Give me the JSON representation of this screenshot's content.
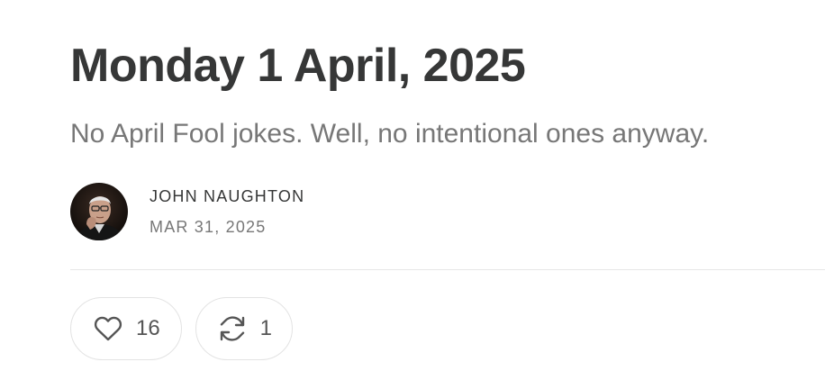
{
  "post": {
    "title": "Monday 1 April, 2025",
    "subtitle": "No April Fool jokes. Well, no intentional ones anyway."
  },
  "byline": {
    "author": "JOHN NAUGHTON",
    "date": "MAR 31, 2025",
    "avatar_icon": "author-avatar"
  },
  "actions": {
    "like": {
      "icon": "heart-icon",
      "count": "16"
    },
    "restack": {
      "icon": "restack-icon",
      "count": "1"
    }
  },
  "colors": {
    "text": "#363737",
    "muted": "#777777",
    "divider": "#e6e6e6",
    "pill_border": "#e3e3e3"
  }
}
